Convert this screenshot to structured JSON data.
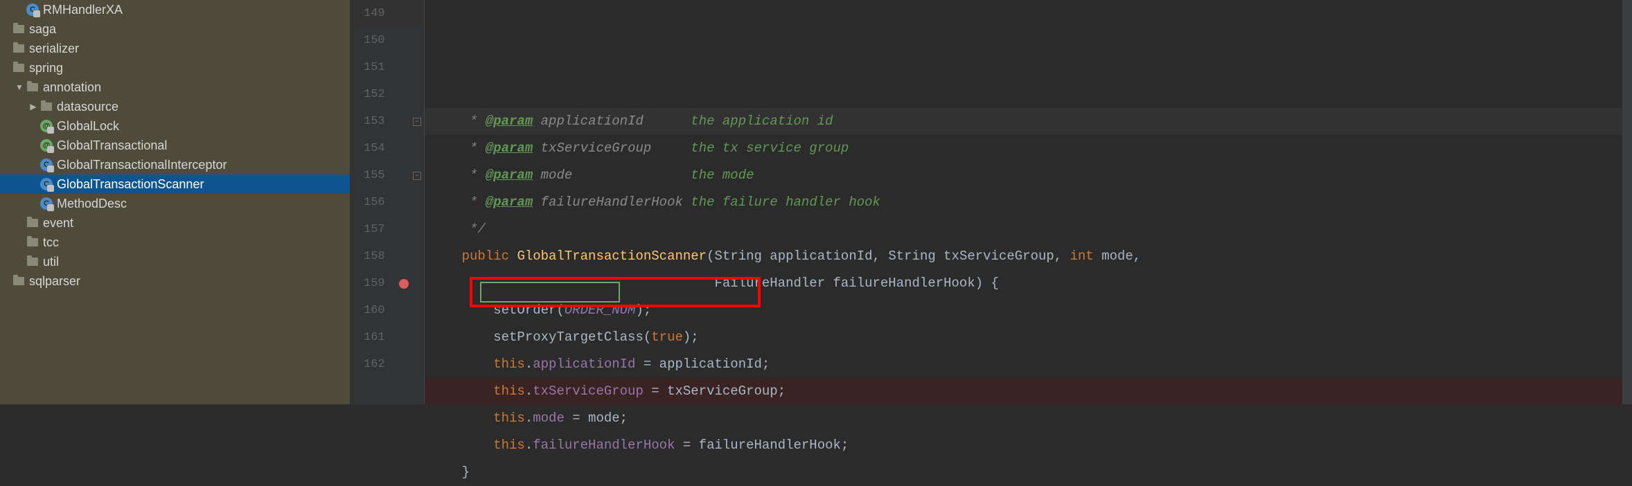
{
  "sidebar": {
    "items": [
      {
        "label": "RMHandlerXA",
        "type": "class",
        "indent": 1
      },
      {
        "label": "saga",
        "type": "folder",
        "indent": 0
      },
      {
        "label": "serializer",
        "type": "folder",
        "indent": 0
      },
      {
        "label": "spring",
        "type": "folder",
        "indent": 0
      },
      {
        "label": "annotation",
        "type": "folder",
        "indent": 1,
        "expanded": true
      },
      {
        "label": "datasource",
        "type": "folder",
        "indent": 2,
        "collapsed": true
      },
      {
        "label": "GlobalLock",
        "type": "annotation",
        "indent": 2
      },
      {
        "label": "GlobalTransactional",
        "type": "annotation",
        "indent": 2
      },
      {
        "label": "GlobalTransactionalInterceptor",
        "type": "class",
        "indent": 2
      },
      {
        "label": "GlobalTransactionScanner",
        "type": "class",
        "indent": 2,
        "selected": true
      },
      {
        "label": "MethodDesc",
        "type": "class",
        "indent": 2
      },
      {
        "label": "event",
        "type": "folder",
        "indent": 1
      },
      {
        "label": "tcc",
        "type": "folder",
        "indent": 1
      },
      {
        "label": "util",
        "type": "folder",
        "indent": 1
      },
      {
        "label": "sqlparser",
        "type": "folder",
        "indent": 0
      }
    ]
  },
  "editor": {
    "first_line": 149,
    "breakpoint_line": 159,
    "active_line": 149,
    "highlight_box": {
      "text": "this.txServiceGroup"
    },
    "lines": [
      {
        "n": 149,
        "tokens": [
          [
            "c-comment",
            "     * "
          ],
          [
            "c-tag",
            "@param"
          ],
          [
            "c-paramname",
            " applicationId      "
          ],
          [
            "c-paramdesc",
            "the application id"
          ]
        ]
      },
      {
        "n": 150,
        "tokens": [
          [
            "c-comment",
            "     * "
          ],
          [
            "c-tag",
            "@param"
          ],
          [
            "c-paramname",
            " txServiceGroup     "
          ],
          [
            "c-paramdesc",
            "the tx service group"
          ]
        ]
      },
      {
        "n": 151,
        "tokens": [
          [
            "c-comment",
            "     * "
          ],
          [
            "c-tag",
            "@param"
          ],
          [
            "c-paramname",
            " mode               "
          ],
          [
            "c-paramdesc",
            "the mode"
          ]
        ]
      },
      {
        "n": 152,
        "tokens": [
          [
            "c-comment",
            "     * "
          ],
          [
            "c-tag",
            "@param"
          ],
          [
            "c-paramname",
            " failureHandlerHook "
          ],
          [
            "c-paramdesc",
            "the failure handler hook"
          ]
        ]
      },
      {
        "n": 153,
        "tokens": [
          [
            "c-comment",
            "     */"
          ]
        ],
        "fold": true
      },
      {
        "n": 154,
        "tokens": [
          [
            "",
            "    "
          ],
          [
            "c-keyword",
            "public "
          ],
          [
            "c-method",
            "GlobalTransactionScanner"
          ],
          [
            "",
            "(String applicationId, String txServiceGroup, "
          ],
          [
            "c-keyword",
            "int "
          ],
          [
            "",
            "mode,"
          ]
        ]
      },
      {
        "n": 155,
        "tokens": [
          [
            "",
            "                                    FailureHandler failureHandlerHook) {"
          ]
        ],
        "fold": true
      },
      {
        "n": 156,
        "tokens": [
          [
            "",
            "        setOrder("
          ],
          [
            "c-const",
            "ORDER_NUM"
          ],
          [
            "",
            ");"
          ]
        ]
      },
      {
        "n": 157,
        "tokens": [
          [
            "",
            "        setProxyTargetClass("
          ],
          [
            "c-literal",
            "true"
          ],
          [
            "",
            ");"
          ]
        ]
      },
      {
        "n": 158,
        "tokens": [
          [
            "",
            "        "
          ],
          [
            "c-keyword",
            "this"
          ],
          [
            "",
            "."
          ],
          [
            "c-field",
            "applicationId "
          ],
          [
            "",
            "= applicationId;"
          ]
        ]
      },
      {
        "n": 159,
        "tokens": [
          [
            "",
            "        "
          ],
          [
            "c-keyword",
            "this"
          ],
          [
            "",
            "."
          ],
          [
            "c-field",
            "txServiceGroup "
          ],
          [
            "",
            "= txServiceGroup;"
          ]
        ],
        "bp": true
      },
      {
        "n": 160,
        "tokens": [
          [
            "",
            "        "
          ],
          [
            "c-keyword",
            "this"
          ],
          [
            "",
            "."
          ],
          [
            "c-field",
            "mode "
          ],
          [
            "",
            "= mode;"
          ]
        ]
      },
      {
        "n": 161,
        "tokens": [
          [
            "",
            "        "
          ],
          [
            "c-keyword",
            "this"
          ],
          [
            "",
            "."
          ],
          [
            "c-field",
            "failureHandlerHook "
          ],
          [
            "",
            "= failureHandlerHook;"
          ]
        ]
      },
      {
        "n": 162,
        "tokens": [
          [
            "",
            "    }"
          ]
        ]
      }
    ]
  }
}
